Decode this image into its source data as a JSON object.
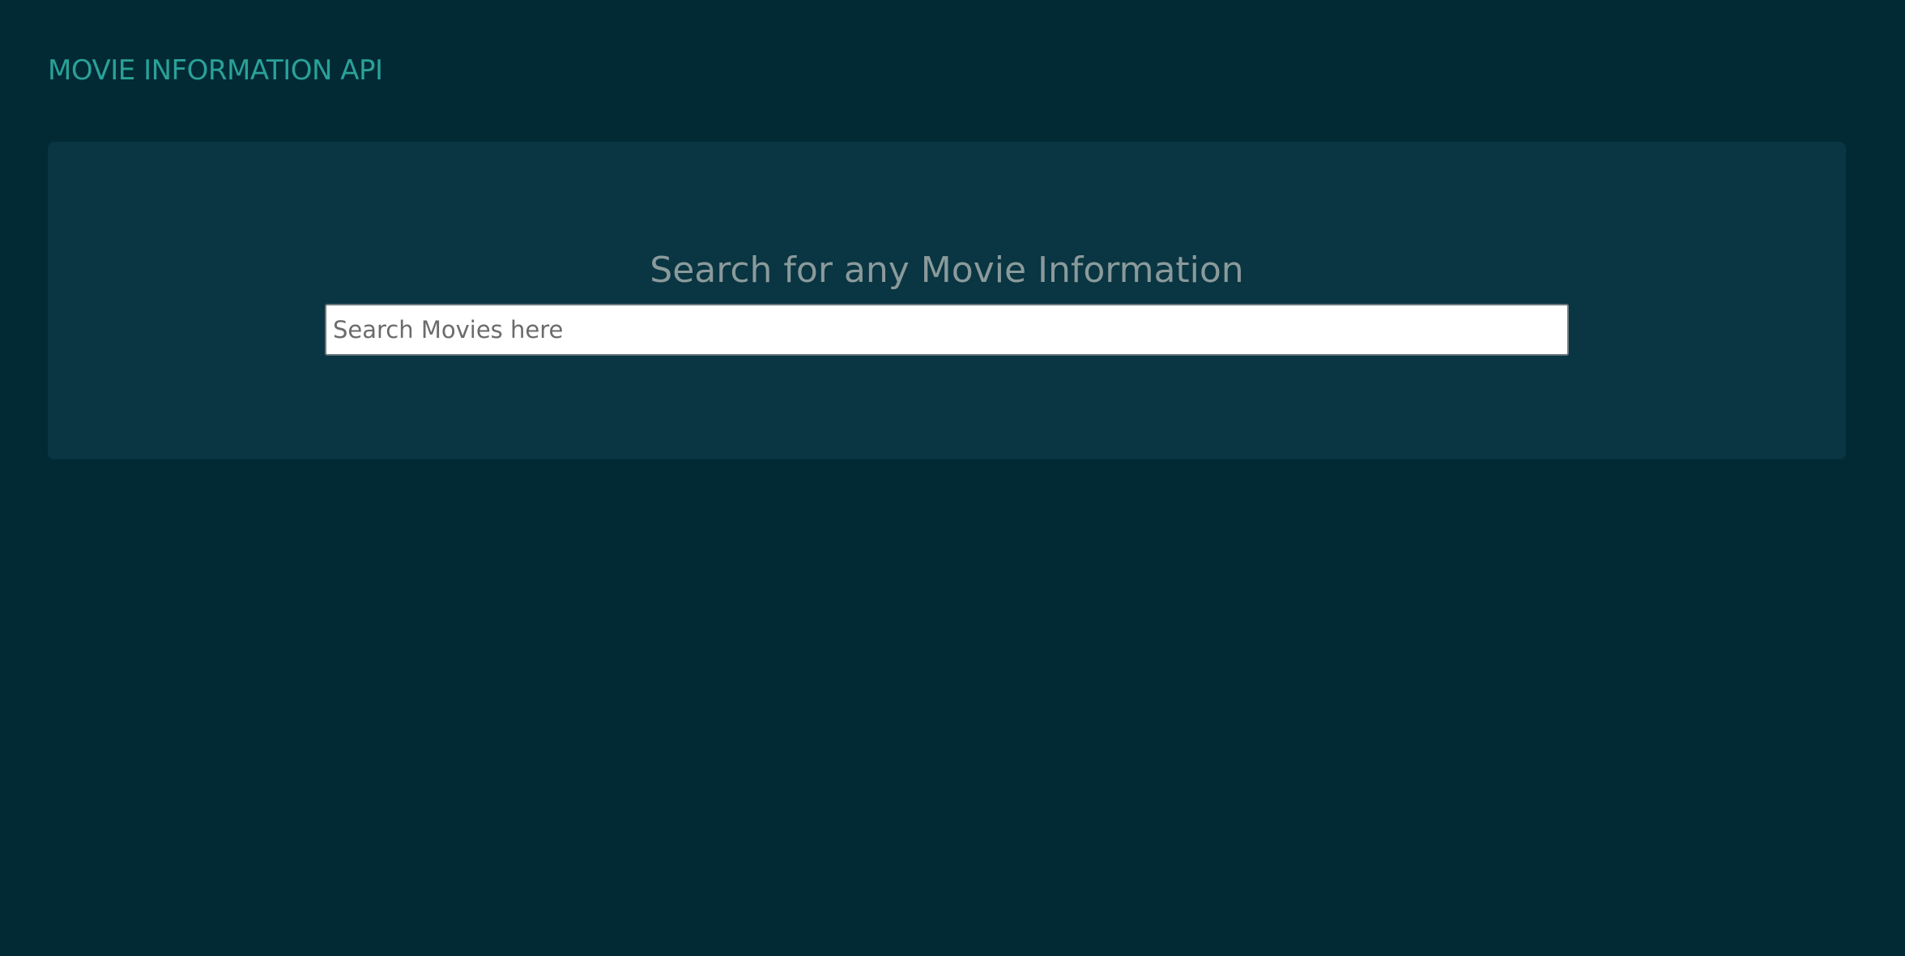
{
  "header": {
    "brand": "MOVIE INFORMATION API"
  },
  "hero": {
    "title": "Search for any Movie Information",
    "search": {
      "placeholder": "Search Movies here",
      "value": ""
    }
  },
  "colors": {
    "page_background": "#022a35",
    "panel_background": "#0a3542",
    "brand_accent": "#2aa198",
    "title_text": "#8a9a9b"
  }
}
